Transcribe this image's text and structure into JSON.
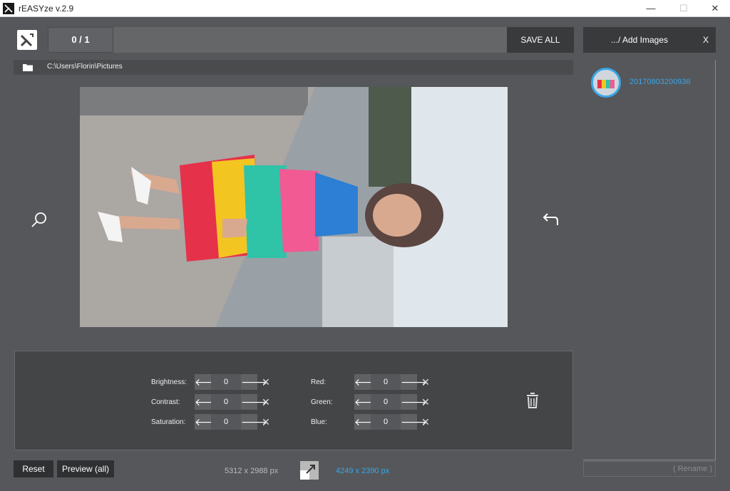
{
  "window": {
    "title": "rEASYze v.2.9",
    "minimize_glyph": "—",
    "maximize_glyph": "☐",
    "close_glyph": "✕"
  },
  "toolbar": {
    "counter": "0 / 1",
    "save_all_label": "SAVE ALL",
    "progress": 0
  },
  "path": {
    "folder_icon": "folder-icon",
    "text": "C:\\Users\\Florin\\Pictures"
  },
  "adjustments": {
    "left": [
      {
        "label": "Brightness:",
        "value": "0"
      },
      {
        "label": "Contrast:",
        "value": "0"
      },
      {
        "label": "Saturation:",
        "value": "0"
      }
    ],
    "right": [
      {
        "label": "Red:",
        "value": "0"
      },
      {
        "label": "Green:",
        "value": "0"
      },
      {
        "label": "Blue:",
        "value": "0"
      }
    ],
    "decrease_glyph": "🡐",
    "increase_glyph": "🡒",
    "reset_glyph": "✕"
  },
  "bottom": {
    "reset_label": "Reset",
    "preview_label": "Preview (all)",
    "original_size": "5312 x 2988 px",
    "new_size": "4249 x 2390 px"
  },
  "sidebar": {
    "add_images_label": ".../ Add Images",
    "clear_label": "X",
    "items": [
      {
        "name": "20170803200936"
      }
    ],
    "rename_label": "( Rename )"
  },
  "colors": {
    "accent": "#3aa6e8",
    "background": "#55575a",
    "panel_dark": "#393a3c"
  }
}
